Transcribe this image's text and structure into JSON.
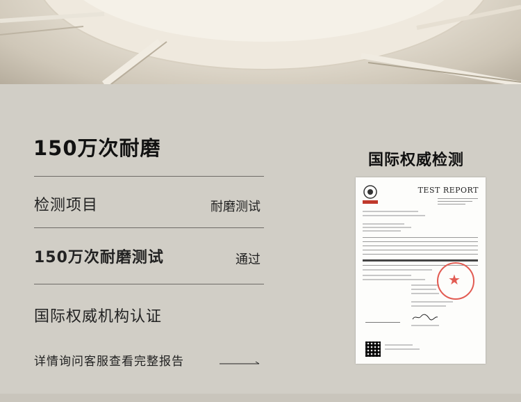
{
  "title": "150万次耐磨",
  "rows": [
    {
      "label": "检测项目",
      "value": "耐磨测试"
    },
    {
      "label": "150万次耐磨测试",
      "value": "通过"
    },
    {
      "label": "国际权威机构认证",
      "value": ""
    }
  ],
  "consult": "详情询问客服查看完整报告",
  "report": {
    "heading": "国际权威检测",
    "document_title": "TEST REPORT"
  }
}
